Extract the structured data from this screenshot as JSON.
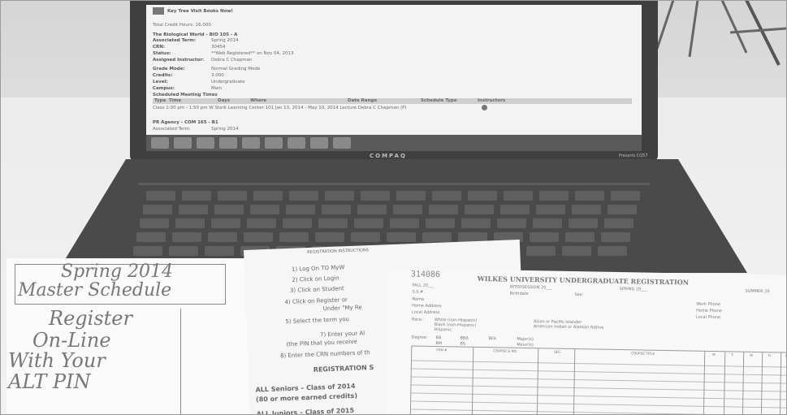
{
  "screen": {
    "header": "Key Tree Visit Books Now!",
    "total_credits": "Total Credit Hours: 16.000",
    "course1": {
      "title": "The Biological World - BIO 105 - A",
      "rows": [
        [
          "Associated Term:",
          "Spring 2014"
        ],
        [
          "CRN:",
          "30454"
        ],
        [
          "Status:",
          "**Web Registered** on Nov 04, 2013"
        ],
        [
          "Assigned Instructor:",
          "Debra C Chapman"
        ],
        [
          "Grade Mode:",
          "Normal Grading Mode"
        ],
        [
          "Credits:",
          "3.000"
        ],
        [
          "Level:",
          "Undergraduate"
        ],
        [
          "Campus:",
          "Main"
        ]
      ]
    },
    "meeting_times_label": "Scheduled Meeting Times",
    "meeting_headers": [
      "Type",
      "Time",
      "Days",
      "Where",
      "Date Range",
      "Schedule Type",
      "Instructors"
    ],
    "meeting_row": "Class  1:00 pm - 1:50 pm  W    Stark Learning Center 101  Jan 13, 2014 - May 10, 2014  Lecture    Debra C Chapman (P)",
    "course2": {
      "title": "PR Agency - COM 165 - B1",
      "rows": [
        [
          "Associated Term:",
          "Spring 2014"
        ]
      ]
    }
  },
  "laptop": {
    "brand": "COMPAQ",
    "model": "Presario CQ57"
  },
  "left_paper": {
    "title_line1": "Spring 2014",
    "title_line2": "Master Schedule",
    "lines": [
      "Register",
      "On-Line",
      "With Your",
      "ALT PIN"
    ]
  },
  "middle_paper": {
    "header": "REGISTRATION INSTRUCTIONS",
    "lines": [
      "1) Log On TO MyW",
      "2) Click on Login",
      "3) Click on Student",
      "4) Click on Register or",
      "Under \"My Re",
      "5) Select the term you",
      "7) Enter your Al",
      "(the PIN that you receive",
      "8) Enter the CRN numbers of th"
    ],
    "schedule_header": "REGISTRATION S",
    "seniors": "ALL  Seniors – Class of 2014",
    "seniors_sub": "(80 or more earned credits)",
    "juniors": "ALL Juniors – Class of 2015"
  },
  "form": {
    "handwritten_number": "314086",
    "title": "WILKES UNIVERSITY UNDERGRADUATE REGISTRATION",
    "term_fields": [
      "FALL 20___",
      "INTERSESSION 20___",
      "SPRING 20___",
      "SUMMER 20"
    ],
    "fields": [
      "S.S.#",
      "Birthdate",
      "Sex:",
      "Name",
      "Home Address",
      "Local Address",
      "Work Phone",
      "Home Phone",
      "Local Phone",
      "Race:",
      "Degree:",
      "Major(s)",
      "Minor(s)"
    ],
    "degree_options": [
      "BA",
      "BBA",
      "BFA",
      "BM",
      "BS"
    ],
    "race_options": [
      "White (non-Hispanic)",
      "Black (non-Hispanic)",
      "Hispanic",
      "Asian or Pacific Islander",
      "American Indian or Alaskan Native"
    ],
    "columns": [
      "CRN #",
      "COURSE & NO.",
      "SEC.",
      "COURSE TITLE",
      "M",
      "T",
      "W",
      "R",
      "F"
    ]
  }
}
